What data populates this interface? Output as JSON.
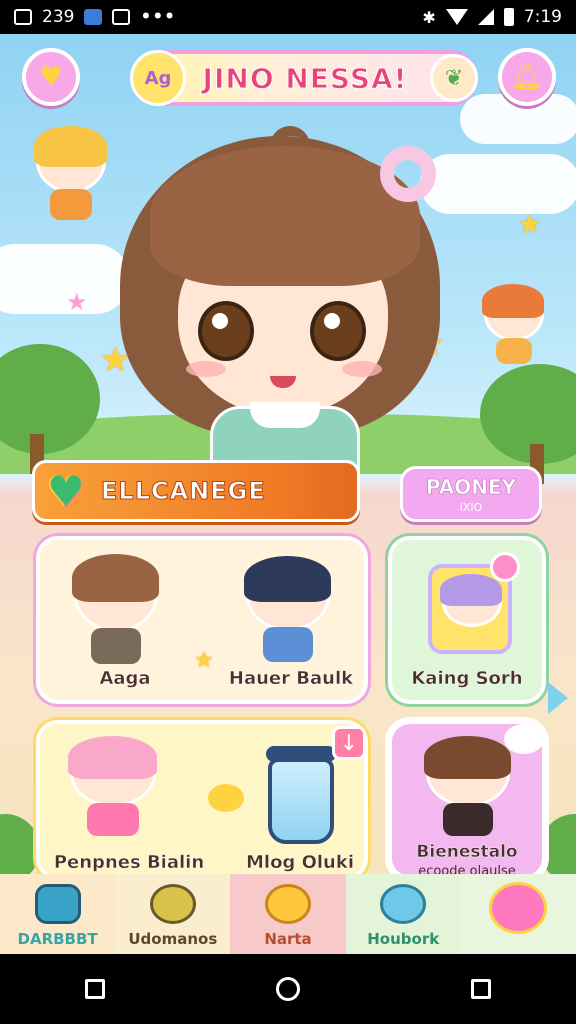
{
  "status_bar": {
    "left_number": "239",
    "time": "7:19"
  },
  "header": {
    "title": "JINO NESSA!",
    "title_badge": "Ag"
  },
  "mid": {
    "banner_label": "ELLCANEGE",
    "money_label": "PAONEY",
    "money_sub": "IXIO"
  },
  "cards": {
    "card1": {
      "left_name": "Aaga",
      "right_name": "Hauer Baulk"
    },
    "card2": {
      "name": "Kaing Sorh"
    },
    "card3": {
      "left_name": "Penpnes Bialin",
      "right_name": "Mlog Oluki"
    },
    "card4": {
      "name": "Bienestalo",
      "sub": "ecoode olaulse"
    }
  },
  "tabs": [
    {
      "label": "DARBBBT",
      "icon": "box-icon",
      "color": "#3aa3a3"
    },
    {
      "label": "Udomanos",
      "icon": "monster-icon",
      "color": "#5a4a2a"
    },
    {
      "label": "Narta",
      "icon": "cat-icon",
      "color": "#b54f2f"
    },
    {
      "label": "Houbork",
      "icon": "slime-icon",
      "color": "#2f8f6a"
    },
    {
      "label": "",
      "icon": "pink-pet-icon",
      "color": "#ff5fa0"
    }
  ],
  "colors": {
    "accent_pink": "#f3a9ef",
    "accent_orange": "#f07a25",
    "sky": "#8fd3f2"
  }
}
